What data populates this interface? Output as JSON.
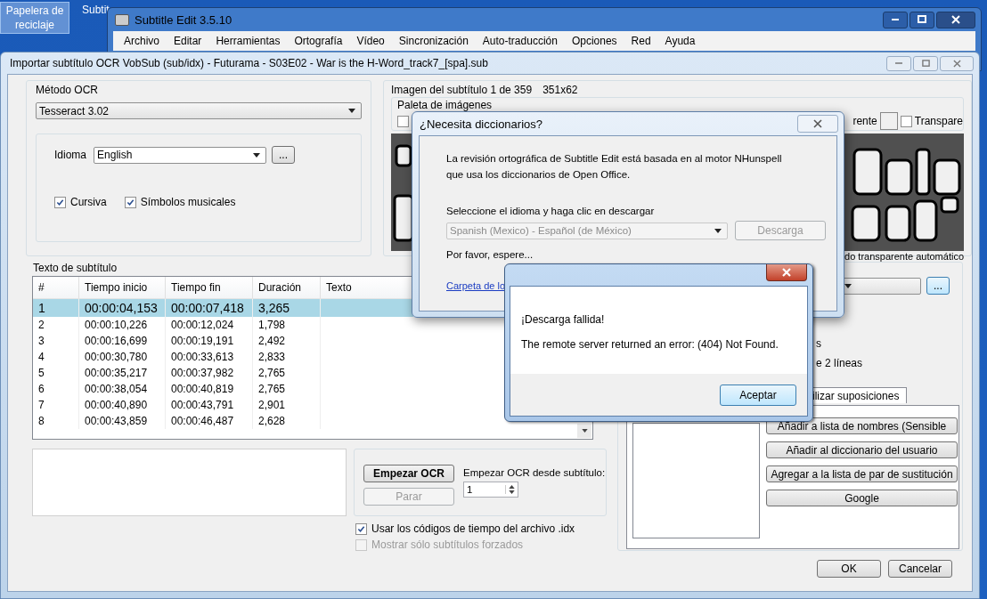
{
  "desktop": {
    "icons": [
      {
        "label": "Papelera de reciclaje",
        "selected": true
      },
      {
        "label": "Subtit",
        "selected": false
      }
    ]
  },
  "app_window": {
    "title": "Subtitle Edit 3.5.10",
    "menu": [
      "Archivo",
      "Editar",
      "Herramientas",
      "Ortografía",
      "Vídeo",
      "Sincronización",
      "Auto-traducción",
      "Opciones",
      "Red",
      "Ayuda"
    ]
  },
  "ocr_dialog": {
    "title": "Importar subtítulo OCR VobSub (sub/idx) - Futurama - S03E02 - War is the H-Word_track7_[spa].sub",
    "ocr_method": {
      "label": "Método OCR",
      "value": "Tesseract 3.02"
    },
    "language": {
      "label": "Idioma",
      "value": "English",
      "browse": "..."
    },
    "options": [
      {
        "label": "Cursiva",
        "checked": true
      },
      {
        "label": "Símbolos musicales",
        "checked": true
      }
    ],
    "image": {
      "title": "Imagen del subtítulo 1 de 359",
      "size": "351x62",
      "palette_label": "Paleta de imágenes",
      "palette_checkbox": {
        "checked": false
      },
      "palette_fragment": "rente",
      "palette_transparent": {
        "label": "Transpare",
        "checked": false
      },
      "auto_transparent": "do transparente automático"
    },
    "subtitles": {
      "label": "Texto de subtítulo",
      "columns": [
        "#",
        "Tiempo inicio",
        "Tiempo fin",
        "Duración",
        "Texto"
      ],
      "rows": [
        {
          "cells": [
            "1",
            "00:00:04,153",
            "00:00:07,418",
            "3,265"
          ],
          "selected": true
        },
        {
          "cells": [
            "2",
            "00:00:10,226",
            "00:00:12,024",
            "1,798"
          ],
          "selected": false
        },
        {
          "cells": [
            "3",
            "00:00:16,699",
            "00:00:19,191",
            "2,492"
          ],
          "selected": false
        },
        {
          "cells": [
            "4",
            "00:00:30,780",
            "00:00:33,613",
            "2,833"
          ],
          "selected": false
        },
        {
          "cells": [
            "5",
            "00:00:35,217",
            "00:00:37,982",
            "2,765"
          ],
          "selected": false
        },
        {
          "cells": [
            "6",
            "00:00:38,054",
            "00:00:40,819",
            "2,765"
          ],
          "selected": false
        },
        {
          "cells": [
            "7",
            "00:00:40,890",
            "00:00:43,791",
            "2,901"
          ],
          "selected": false
        },
        {
          "cells": [
            "8",
            "00:00:43,859",
            "00:00:46,487",
            "2,628"
          ],
          "selected": false
        }
      ]
    },
    "ocr_controls": {
      "start": "Empezar OCR",
      "stop": {
        "label": "Parar",
        "disabled": true
      },
      "start_from_label": "Empezar OCR desde subtítulo:",
      "start_from": "1"
    },
    "checks": [
      {
        "label": "Usar los códigos de tiempo del archivo .idx",
        "checked": true,
        "disabled": false
      },
      {
        "label": "Mostrar sólo subtítulos forzados",
        "checked": false,
        "disabled": true
      }
    ],
    "spell_panel": {
      "browse": "...",
      "fragments": [
        "s",
        "e 2 líneas"
      ],
      "tab": "ilizar suposiciones",
      "buttons": [
        "Añadir a lista de nombres (Sensible",
        "Añadir al diccionario del usuario",
        "Agregar a la lista de par de sustitución",
        "Google"
      ]
    },
    "buttons": [
      "OK",
      "Cancelar"
    ]
  },
  "dict_dialog": {
    "title": "¿Necesita diccionarios?",
    "message": "La revisión ortográfica de Subtitle Edit está basada en al motor NHunspell que usa los diccionarios de Open Office.",
    "prompt": "Seleccione el idioma y haga clic en descargar",
    "language": {
      "value": "Spanish (Mexico) - Español (de México)",
      "disabled": true
    },
    "download": {
      "label": "Descarga",
      "disabled": true
    },
    "status": "Por favor, espere...",
    "link": "Carpeta de lo"
  },
  "error_dialog": {
    "heading": "¡Descarga fallida!",
    "message": "The remote server returned an error: (404) Not Found.",
    "button": "Aceptar"
  }
}
